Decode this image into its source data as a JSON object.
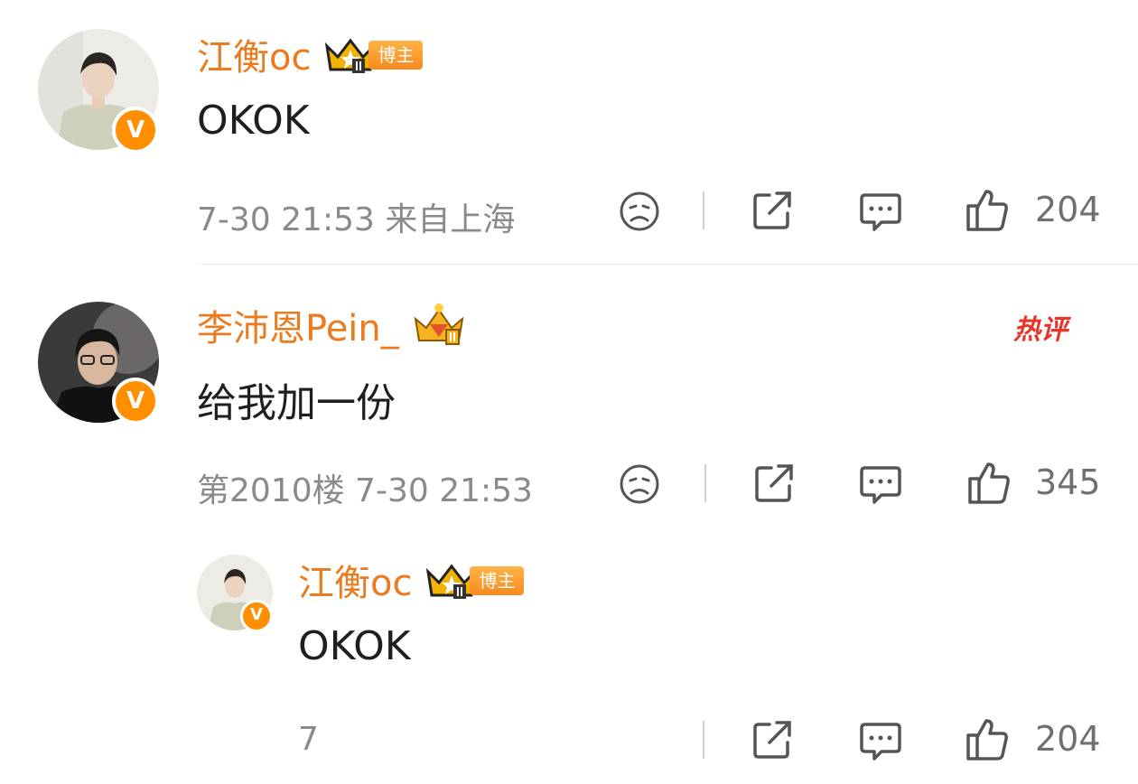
{
  "colors": {
    "username": "#ec7a1f",
    "verified": "#ff8f00",
    "hot": "#e8352a"
  },
  "comments": [
    {
      "username": "江衡oc",
      "role_badge": "博主",
      "text": "OKOK",
      "meta": "7-30 21:53 来自上海",
      "likes": "204",
      "icons": [
        "dislike-face-icon",
        "share-icon",
        "reply-bubble-icon",
        "thumbs-up-icon"
      ]
    },
    {
      "username": "李沛恩Pein_",
      "hot_badge": "热评",
      "text": "给我加一份",
      "meta": "第2010楼 7-30 21:53",
      "likes": "345",
      "reply": {
        "username": "江衡oc",
        "role_badge": "博主",
        "text": "OKOK",
        "meta": "7",
        "likes": "204"
      }
    }
  ]
}
